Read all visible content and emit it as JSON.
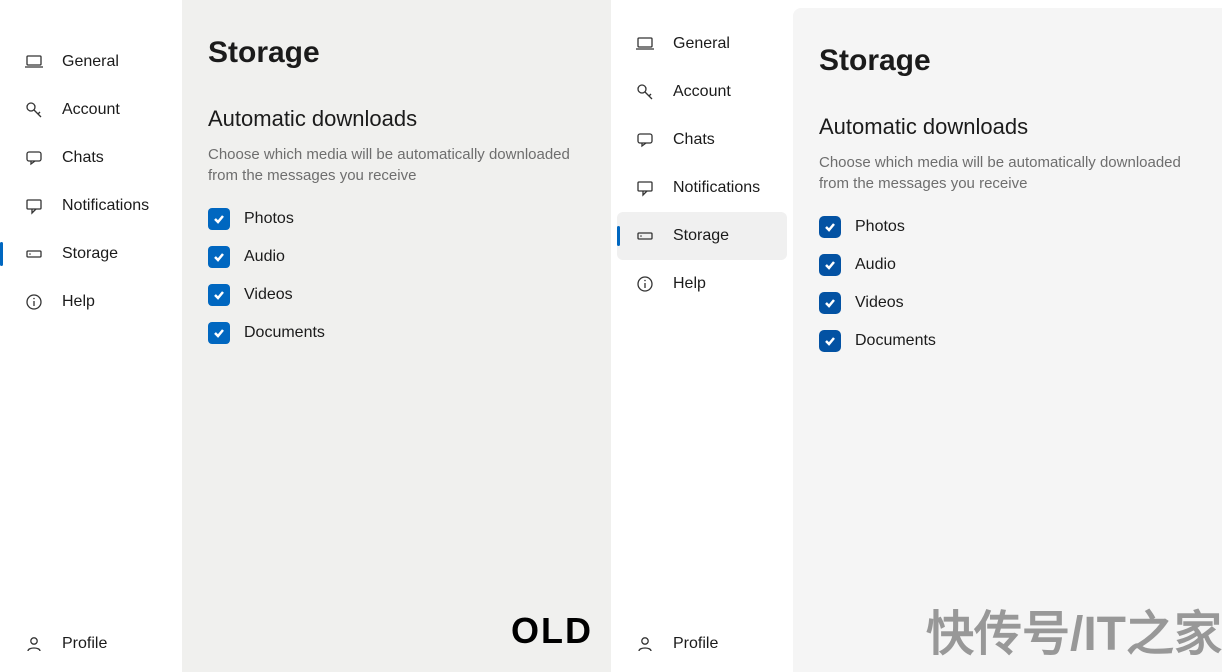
{
  "left": {
    "sidebar": {
      "items": [
        {
          "label": "General",
          "icon": "laptop"
        },
        {
          "label": "Account",
          "icon": "key"
        },
        {
          "label": "Chats",
          "icon": "chat"
        },
        {
          "label": "Notifications",
          "icon": "comment"
        },
        {
          "label": "Storage",
          "icon": "storage",
          "active": true
        },
        {
          "label": "Help",
          "icon": "info"
        }
      ],
      "profile_label": "Profile"
    },
    "page_title": "Storage",
    "section_title": "Automatic downloads",
    "section_desc": "Choose which media will be automatically downloaded from the messages you receive",
    "options": [
      {
        "label": "Photos",
        "checked": true
      },
      {
        "label": "Audio",
        "checked": true
      },
      {
        "label": "Videos",
        "checked": true
      },
      {
        "label": "Documents",
        "checked": true
      }
    ],
    "badge": "OLD"
  },
  "right": {
    "sidebar": {
      "items": [
        {
          "label": "General",
          "icon": "laptop"
        },
        {
          "label": "Account",
          "icon": "key"
        },
        {
          "label": "Chats",
          "icon": "chat"
        },
        {
          "label": "Notifications",
          "icon": "comment"
        },
        {
          "label": "Storage",
          "icon": "storage",
          "active": true
        },
        {
          "label": "Help",
          "icon": "info"
        }
      ],
      "profile_label": "Profile"
    },
    "page_title": "Storage",
    "section_title": "Automatic downloads",
    "section_desc": "Choose which media will be automatically downloaded from the messages you receive",
    "options": [
      {
        "label": "Photos",
        "checked": true
      },
      {
        "label": "Audio",
        "checked": true
      },
      {
        "label": "Videos",
        "checked": true
      },
      {
        "label": "Documents",
        "checked": true
      }
    ]
  },
  "watermark": "快传号/IT之家"
}
